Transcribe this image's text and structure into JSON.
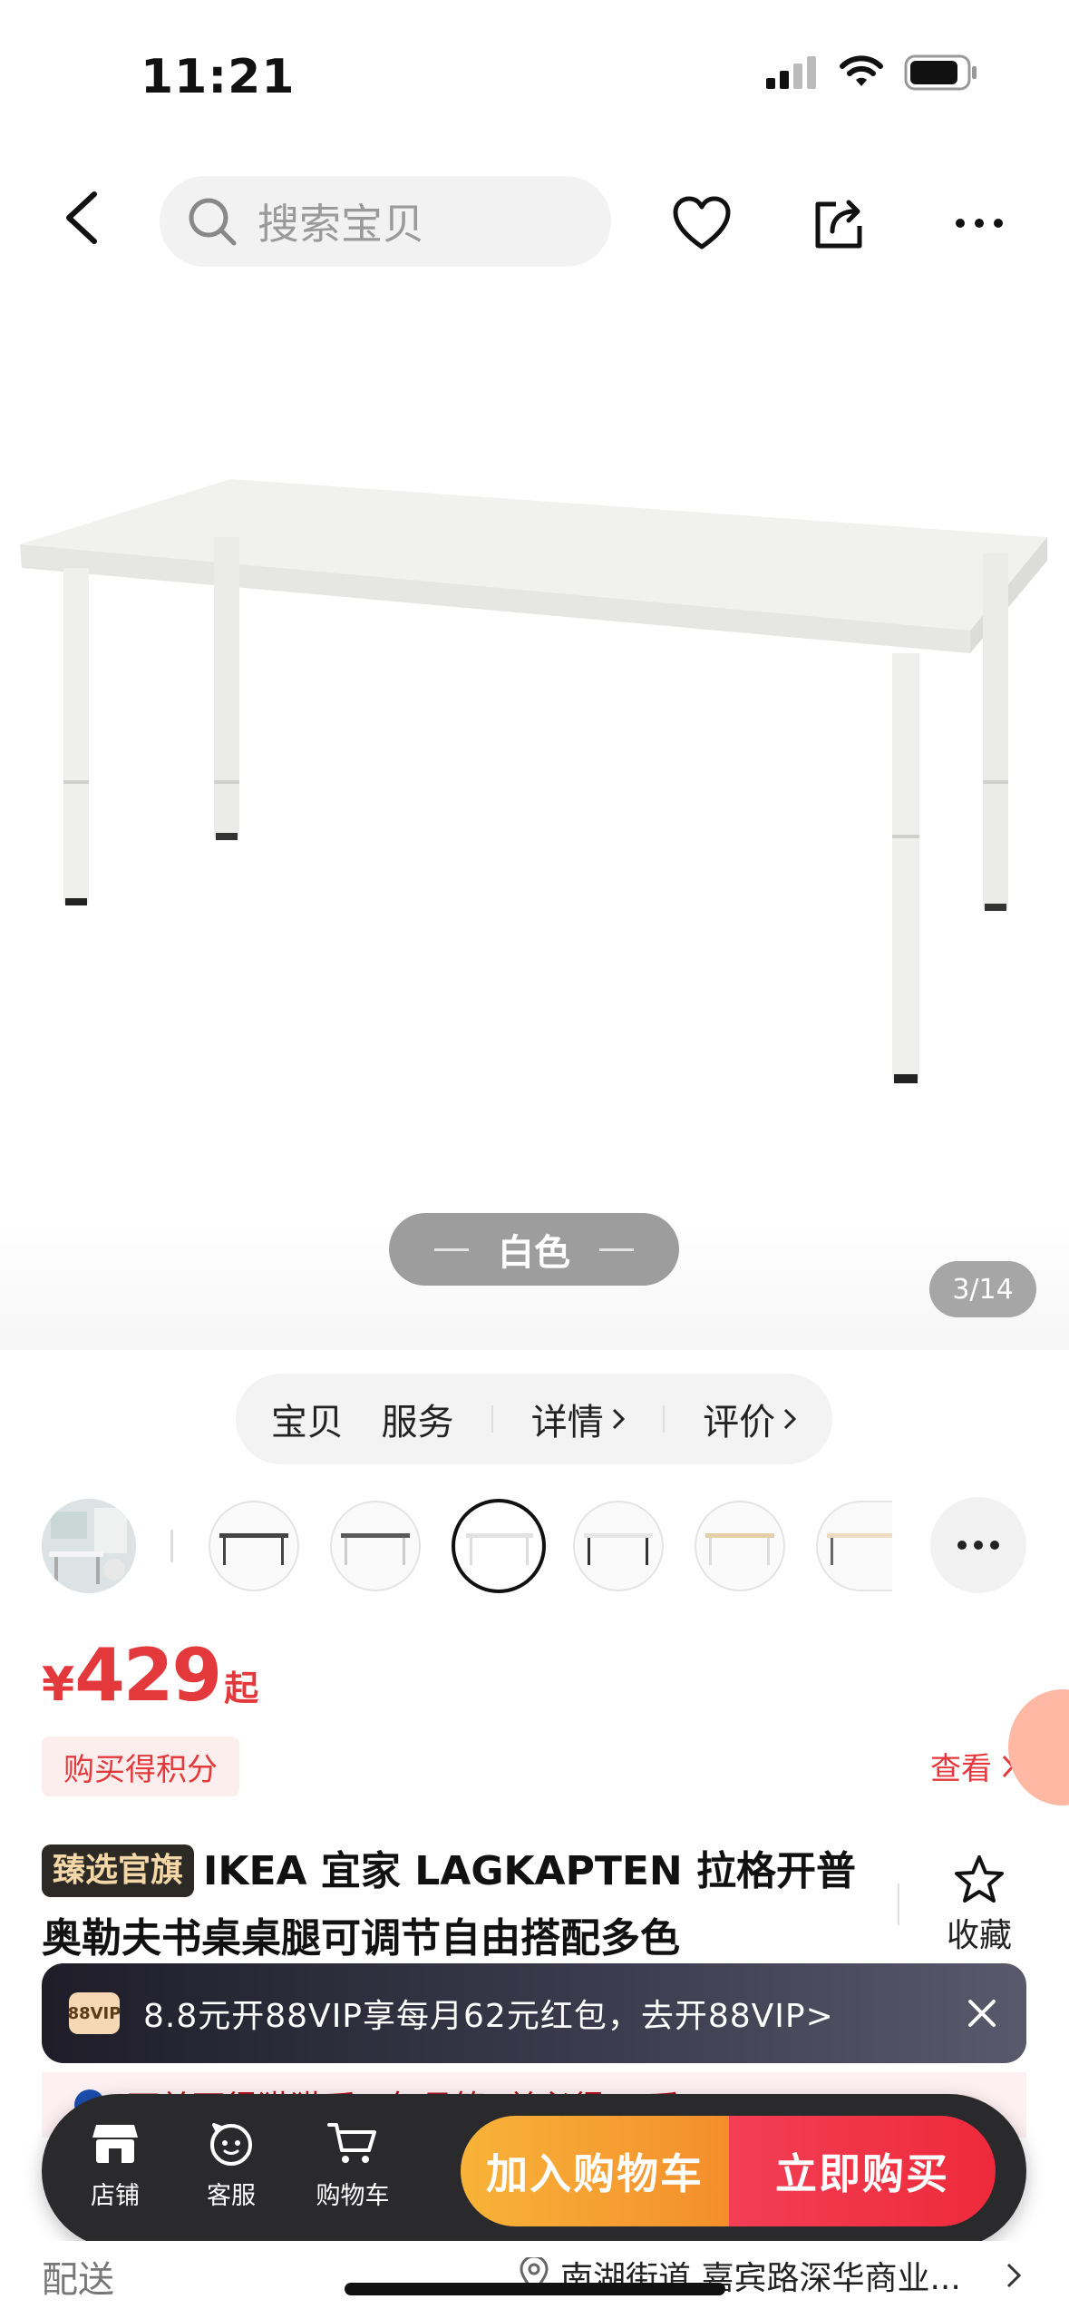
{
  "status_bar": {
    "time": "11:21"
  },
  "top_nav": {
    "search_placeholder": "搜索宝贝"
  },
  "hero": {
    "color_label": "白色",
    "image_counter": "3/14"
  },
  "tabs": [
    {
      "label": "宝贝",
      "has_chevron": false
    },
    {
      "label": "服务",
      "has_chevron": false
    },
    {
      "label": "详情",
      "has_chevron": true
    },
    {
      "label": "评价",
      "has_chevron": true
    }
  ],
  "price": {
    "symbol": "¥",
    "value": "429",
    "suffix": "起"
  },
  "points_badge": "购买得积分",
  "view_link": "查看",
  "title": {
    "badge": "臻选官旗",
    "text": "IKEA 宜家 LAGKAPTEN 拉格开普奥勒夫书桌桌腿可调节自由搭配多色"
  },
  "favorite_label": "收藏",
  "vip_banner": {
    "logo": "88VIP",
    "text": "8.8元开88VIP享每月62元红包，去开88VIP>"
  },
  "coin_strip": "下单可得猫猫币，每月第3单必得99币",
  "bottom_bar": {
    "shop_label": "店铺",
    "service_label": "客服",
    "cart_label": "购物车",
    "add_to_cart": "加入购物车",
    "buy_now": "立即购买"
  },
  "delivery": {
    "label": "配送",
    "address": "南湖街道 嘉宾路深华商业..."
  },
  "colors": {
    "accent_red": "#e4393c",
    "cart_orange": "#f48e2c",
    "buy_red": "#ee2a3a"
  }
}
